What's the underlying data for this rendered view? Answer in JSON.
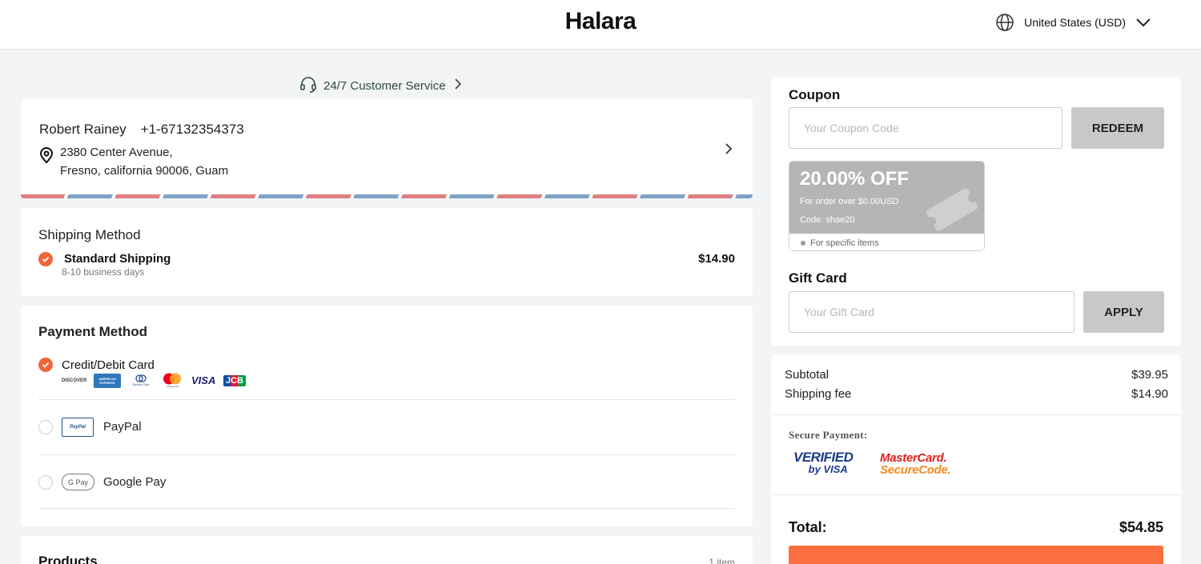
{
  "header": {
    "brand": "Halara",
    "region": "United States (USD)"
  },
  "customer_service": {
    "label": "24/7 Customer Service"
  },
  "address": {
    "name": "Robert Rainey",
    "phone": "+1-67132354373",
    "line1": "2380 Center Avenue,",
    "line2": "Fresno, california 90006, Guam"
  },
  "shipping": {
    "title": "Shipping Method",
    "option_name": "Standard Shipping",
    "option_eta": "8-10 business days",
    "option_price": "$14.90"
  },
  "payment": {
    "title": "Payment Method",
    "options": [
      {
        "label": "Credit/Debit Card",
        "selected": true
      },
      {
        "label": "PayPal",
        "selected": false
      },
      {
        "label": "Google Pay",
        "selected": false
      }
    ],
    "card_brands": [
      "DISCOVER",
      "AMERICAN EXPRESS",
      "Diners Club",
      "mastercard",
      "VISA",
      "JCB"
    ],
    "paypal_badge": "PayPal",
    "gpay_badge": "G Pay"
  },
  "products": {
    "title": "Products",
    "count": "1 item"
  },
  "coupon": {
    "title": "Coupon",
    "placeholder": "Your Coupon Code",
    "button": "REDEEM",
    "offer": {
      "headline": "20.00% OFF",
      "condition": "For order over $0.00USD",
      "code": "Code: shae20",
      "note": "For specific items"
    }
  },
  "gift_card": {
    "title": "Gift Card",
    "placeholder": "Your Gift Card",
    "button": "APPLY"
  },
  "summary": {
    "subtotal_label": "Subtotal",
    "subtotal_value": "$39.95",
    "shipping_label": "Shipping fee",
    "shipping_value": "$14.90",
    "secure_label": "Secure Payment:",
    "verified_visa_line1": "VERIFIED",
    "verified_visa_line2": "by VISA",
    "mc_secure_line1": "MasterCard.",
    "mc_secure_line2": "SecureCode.",
    "total_label": "Total:",
    "total_value": "$54.85"
  },
  "colors": {
    "accent": "#fa6f3d",
    "check": "#f0663a",
    "button_grey": "#c8c8c8",
    "coupon_grey": "#b5b5b5"
  }
}
